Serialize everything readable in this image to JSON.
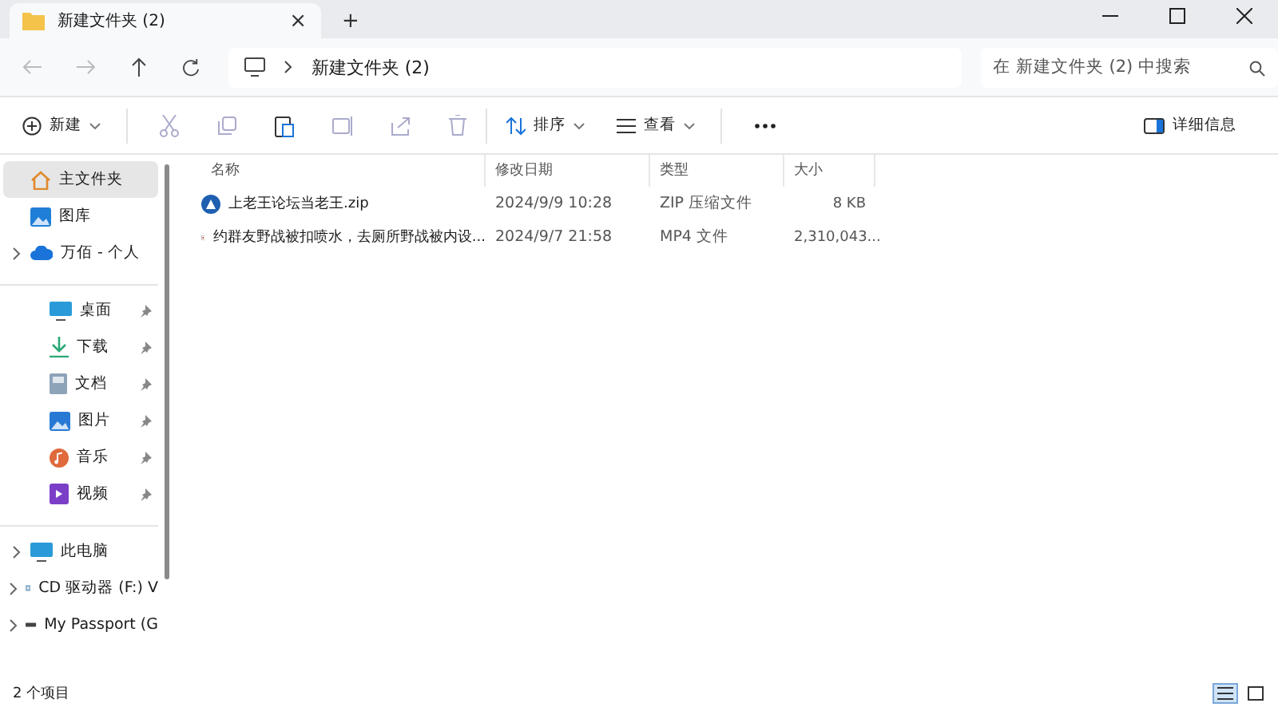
{
  "tab": {
    "title": "新建文件夹 (2)",
    "close": "×"
  },
  "new_tab": "+",
  "address": {
    "crumb": "新建文件夹 (2)"
  },
  "search": {
    "placeholder": "在 新建文件夹 (2) 中搜索"
  },
  "toolbar": {
    "new": "新建",
    "sort": "排序",
    "view": "查看",
    "details": "详细信息"
  },
  "columns": [
    "名称",
    "修改日期",
    "类型",
    "大小"
  ],
  "rows": [
    {
      "kind": "zip",
      "name": "上老王论坛当老王.zip",
      "date": "2024/9/9 10:28",
      "type": "ZIP 压缩文件",
      "size": "8 KB"
    },
    {
      "kind": "video",
      "name": "约群友野战被扣喷水，去厕所野战被内设...",
      "date": "2024/9/7 21:58",
      "type": "MP4 文件",
      "size": "2,310,043..."
    }
  ],
  "sidebar": [
    [
      {
        "kind": "home",
        "label": "主文件夹",
        "selected": true,
        "expander": false,
        "pinned": false
      },
      {
        "kind": "gallery",
        "label": "图库",
        "selected": false,
        "expander": false,
        "pinned": false
      },
      {
        "kind": "cloud",
        "label": "万佰 - 个人",
        "selected": false,
        "expander": true,
        "pinned": false
      }
    ],
    [
      {
        "kind": "desktop",
        "label": "桌面",
        "selected": false,
        "expander": false,
        "pinned": true
      },
      {
        "kind": "download",
        "label": "下载",
        "selected": false,
        "expander": false,
        "pinned": true
      },
      {
        "kind": "document",
        "label": "文档",
        "selected": false,
        "expander": false,
        "pinned": true
      },
      {
        "kind": "picture",
        "label": "图片",
        "selected": false,
        "expander": false,
        "pinned": true
      },
      {
        "kind": "music",
        "label": "音乐",
        "selected": false,
        "expander": false,
        "pinned": true
      },
      {
        "kind": "video",
        "label": "视频",
        "selected": false,
        "expander": false,
        "pinned": true
      }
    ],
    [
      {
        "kind": "pc",
        "label": "此电脑",
        "selected": false,
        "expander": true,
        "pinned": false
      },
      {
        "kind": "cd",
        "label": "CD 驱动器 (F:) V",
        "selected": false,
        "expander": true,
        "pinned": false
      },
      {
        "kind": "drive",
        "label": "My Passport (G",
        "selected": false,
        "expander": true,
        "pinned": false
      }
    ]
  ],
  "status": "2 个项目",
  "view_modes": [
    {
      "kind": "details",
      "selected": true
    },
    {
      "kind": "tiles",
      "selected": false
    }
  ]
}
